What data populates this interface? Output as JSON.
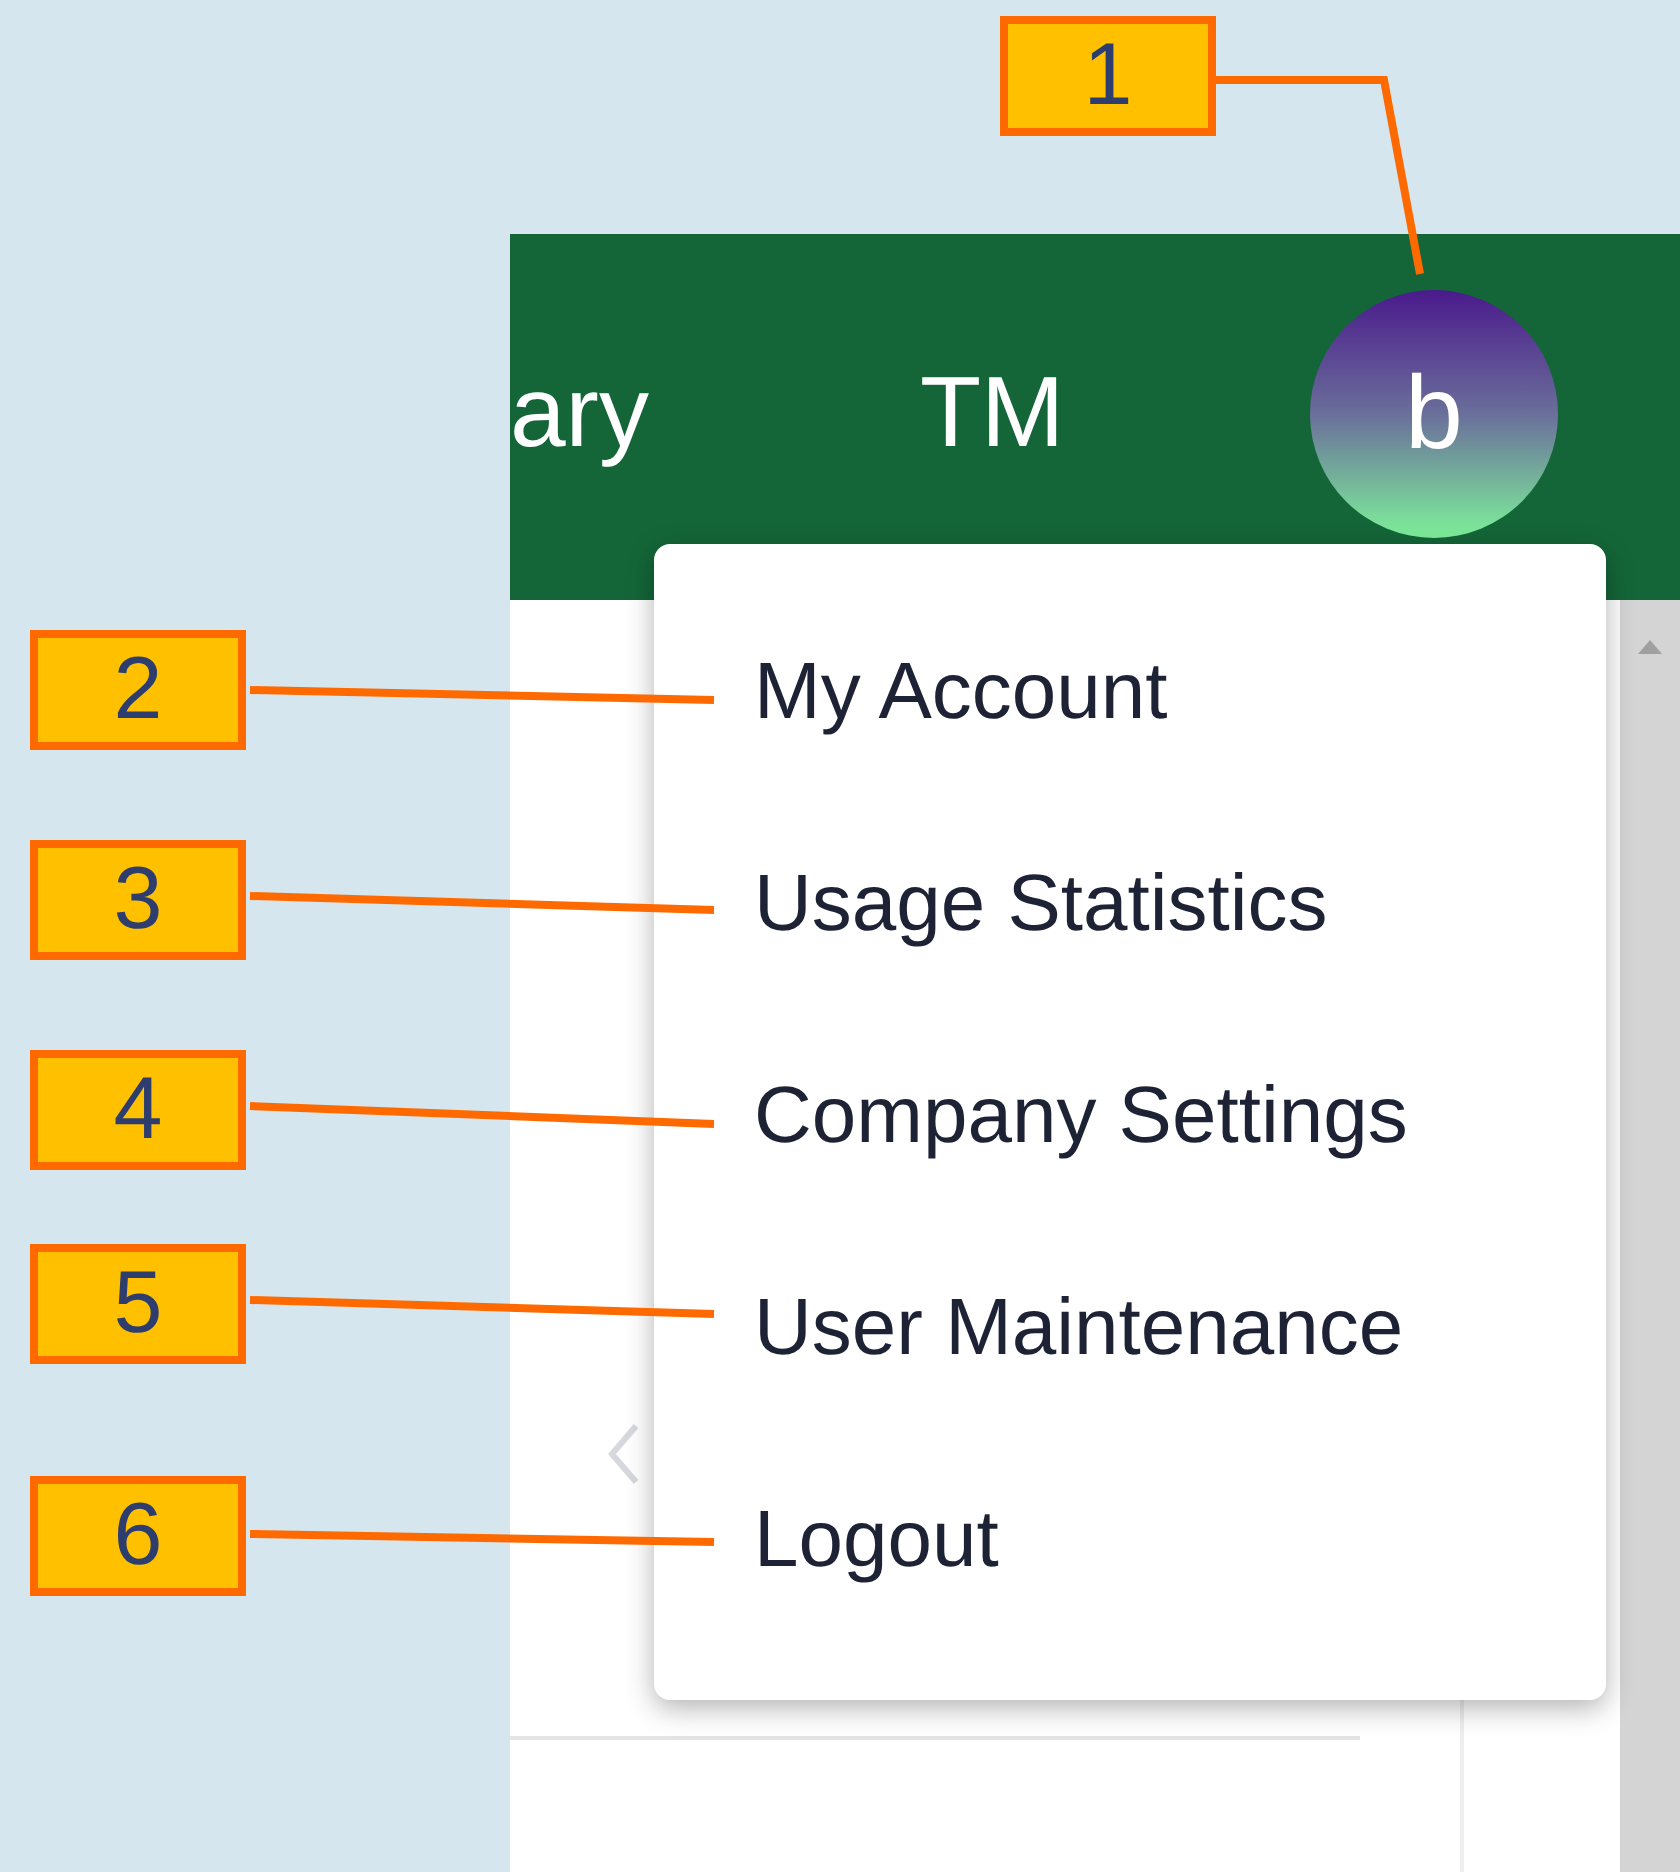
{
  "header": {
    "nav_items": [
      "ary",
      "TM"
    ],
    "avatar_letter": "b"
  },
  "menu": {
    "items": [
      "My Account",
      "Usage Statistics",
      "Company Settings",
      "User Maintenance",
      "Logout"
    ]
  },
  "callouts": [
    "1",
    "2",
    "3",
    "4",
    "5",
    "6"
  ]
}
